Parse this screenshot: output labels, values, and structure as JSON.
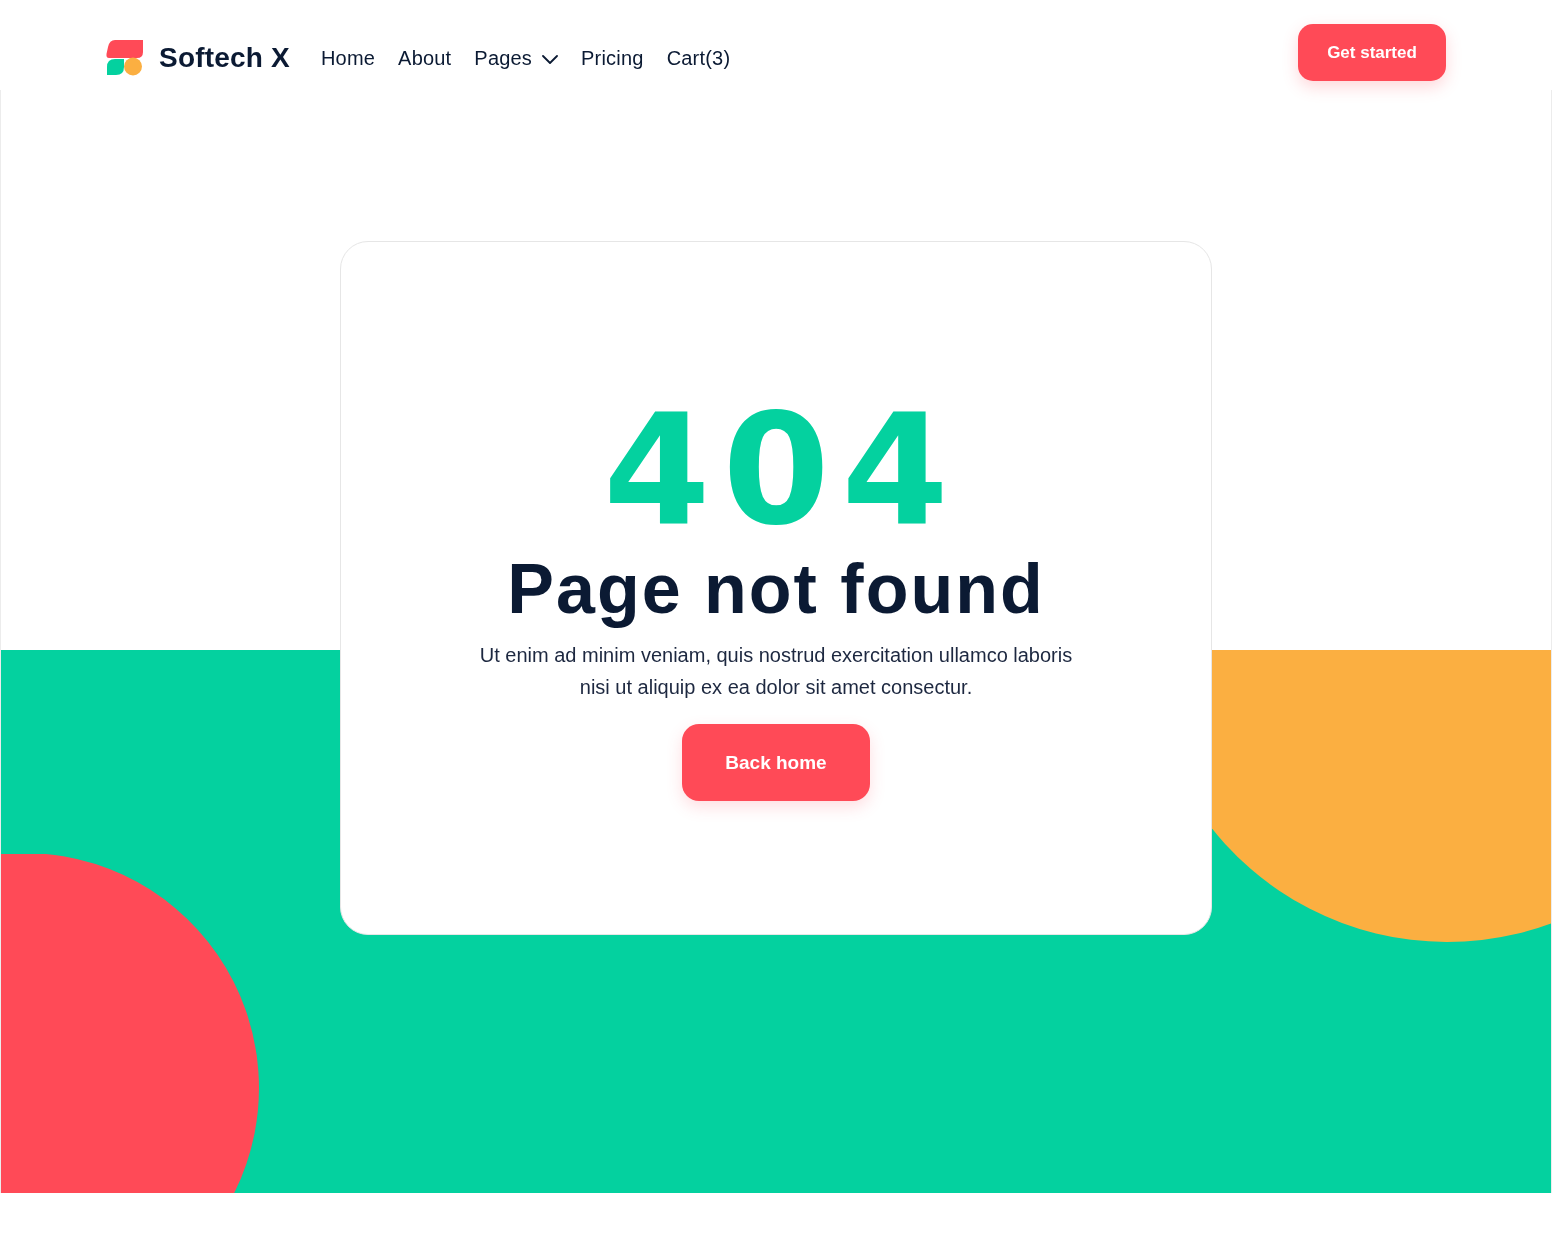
{
  "header": {
    "logo": {
      "name": "Softech X"
    },
    "nav": [
      {
        "label": "Home",
        "kind": "link"
      },
      {
        "label": "About",
        "kind": "link"
      },
      {
        "label": "Pages",
        "kind": "dropdown"
      },
      {
        "label": "Pricing",
        "kind": "link"
      },
      {
        "label": "Cart(3)",
        "kind": "link"
      }
    ],
    "cta": "Get started"
  },
  "error_card": {
    "code": "404",
    "title": "Page not found",
    "message": "Ut enim ad minim veniam, quis nostrud exercitation ullamco laboris nisi ut aliquip ex ea dolor sit amet consectur.",
    "button": "Back home"
  }
}
